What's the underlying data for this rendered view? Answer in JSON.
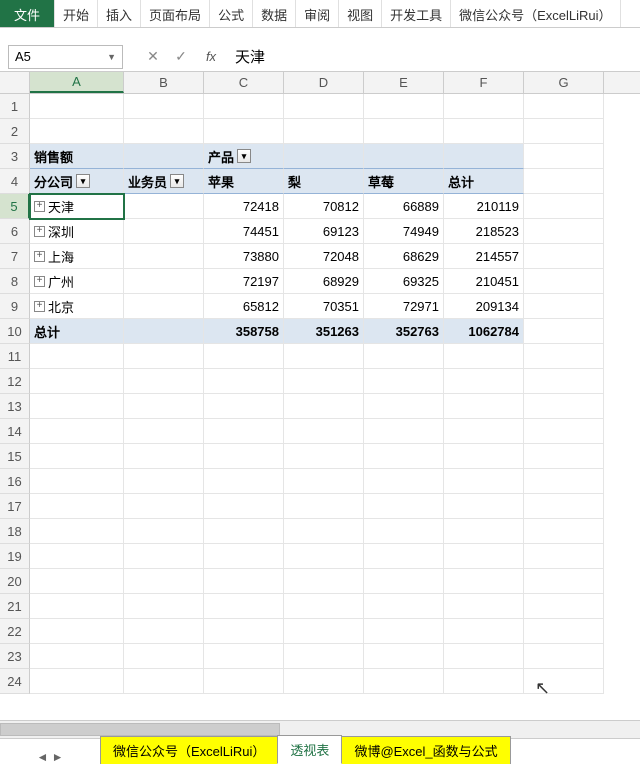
{
  "ribbon": {
    "file": "文件",
    "tabs": [
      "开始",
      "插入",
      "页面布局",
      "公式",
      "数据",
      "审阅",
      "视图",
      "开发工具",
      "微信公众号（ExcelLiRui）"
    ]
  },
  "nameBox": "A5",
  "formulaBar": "天津",
  "columns": [
    "A",
    "B",
    "C",
    "D",
    "E",
    "F",
    "G"
  ],
  "pivot": {
    "r3": {
      "sales": "销售额",
      "product": "产品"
    },
    "r4": {
      "branch": "分公司",
      "rep": "业务员",
      "c1": "苹果",
      "c2": "梨",
      "c3": "草莓",
      "c4": "总计"
    },
    "rows": [
      {
        "name": "天津",
        "v": [
          "72418",
          "70812",
          "66889",
          "210119"
        ]
      },
      {
        "name": "深圳",
        "v": [
          "74451",
          "69123",
          "74949",
          "218523"
        ]
      },
      {
        "name": "上海",
        "v": [
          "73880",
          "72048",
          "68629",
          "214557"
        ]
      },
      {
        "name": "广州",
        "v": [
          "72197",
          "68929",
          "69325",
          "210451"
        ]
      },
      {
        "name": "北京",
        "v": [
          "65812",
          "70351",
          "72971",
          "209134"
        ]
      }
    ],
    "grand": {
      "label": "总计",
      "v": [
        "358758",
        "351263",
        "352763",
        "1062784"
      ]
    }
  },
  "sheets": {
    "s1": "微信公众号（ExcelLiRui）",
    "s2": "透视表",
    "s3": "微博@Excel_函数与公式"
  },
  "rowCount": 24
}
